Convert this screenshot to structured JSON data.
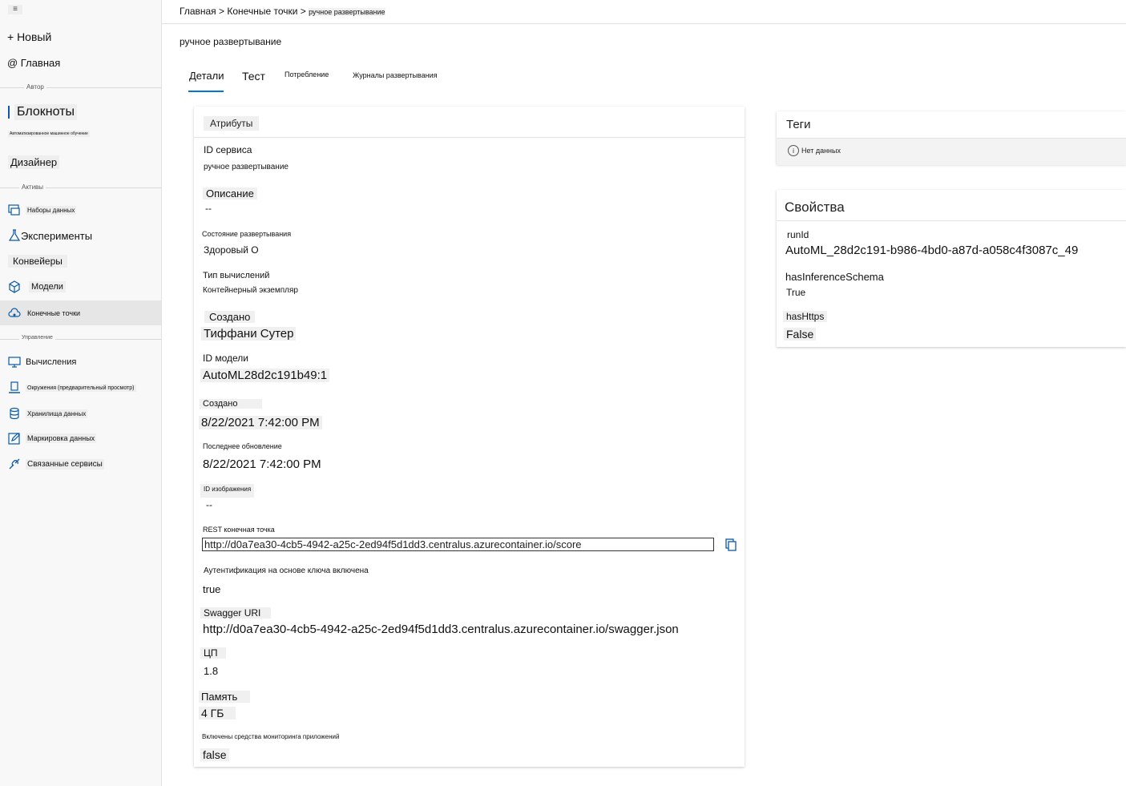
{
  "sidebar": {
    "menu_glyph": "≡",
    "new_label": "+ Новый",
    "home_label": "@ Главная",
    "section_author": "Автор",
    "notebooks": "Блокноты",
    "automl": "Автоматизированное машинное обучение",
    "designer": "Дизайнер",
    "section_assets": "Активы",
    "datasets": "Наборы данных",
    "experiments": "Эксперименты",
    "pipelines": "Конвейеры",
    "models": "Модели",
    "endpoints": "Конечные точки",
    "section_manage": "Управление",
    "compute": "Вычисления",
    "environments": "Окружения (предварительный просмотр)",
    "datastores": "Хранилища данных",
    "labeling": "Маркировка данных",
    "linked": "Связанные сервисы"
  },
  "breadcrumb": {
    "home": "Главная",
    "sep1": ">",
    "endpoints": "Конечные точки",
    "sep2": ">",
    "current": "ручное развертывание"
  },
  "page_title": "ручное развертывание",
  "tabs": {
    "details": "Детали",
    "test": "Тест",
    "consume": "Потребление",
    "logs": "Журналы развертывания"
  },
  "attributes": {
    "header": "Атрибуты",
    "service_id_label": "ID сервиса",
    "service_id_value": "ручное развертывание",
    "description_label": "Описание",
    "description_value": "--",
    "state_label": "Состояние развертывания",
    "state_value": "Здоровый О",
    "compute_type_label": "Тип вычислений",
    "compute_type_value": "Контейнерный экземпляр",
    "created_by_label": "Создано",
    "created_by_value": "Тиффани Сутер",
    "model_id_label": "ID модели",
    "model_id_value": "AutoML28d2c191b49:1",
    "created_on_label": "Создано",
    "created_on_value": "8/22/2021 7:42:00 PM",
    "updated_label": "Последнее обновление",
    "updated_value": "8/22/2021 7:42:00 PM",
    "image_id_label": "ID изображения",
    "image_id_value": "--",
    "rest_label": "REST конечная точка",
    "rest_value": "http://d0a7ea30-4cb5-4942-a25c-2ed94f5d1dd3.centralus.azurecontainer.io/score",
    "auth_label": "Аутентификация на основе ключа включена",
    "auth_value": "true",
    "swagger_label": "Swagger URI",
    "swagger_value": "http://d0a7ea30-4cb5-4942-a25c-2ed94f5d1dd3.centralus.azurecontainer.io/swagger.json",
    "cpu_label": "ЦП",
    "cpu_value": "1.8",
    "memory_label": "Память",
    "memory_value": "4 ГБ",
    "appinsights_label": "Включены средства мониторинга приложений",
    "appinsights_value": "false"
  },
  "tags": {
    "title": "Теги",
    "empty": "Нет данных"
  },
  "properties": {
    "title": "Свойства",
    "runid_label": "runId",
    "runid_value": "AutoML_28d2c191-b986-4bd0-a87d-a058c4f3087c_49",
    "schema_label": "hasInferenceSchema",
    "schema_value": "True",
    "https_label": "hasHttps",
    "https_value": "False"
  },
  "colors": {
    "accent": "#0078d4",
    "icon": "#0a5aa8"
  }
}
